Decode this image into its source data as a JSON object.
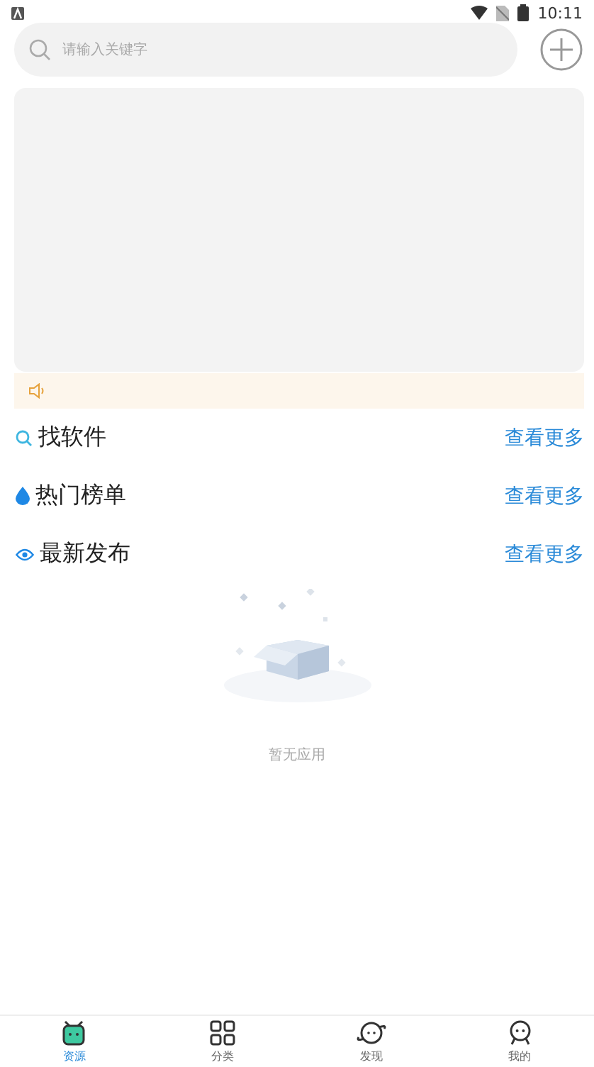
{
  "status_bar": {
    "time": "10:11"
  },
  "search": {
    "placeholder": "请输入关键字"
  },
  "sections": [
    {
      "kind": "search",
      "title": "找软件",
      "more": "查看更多"
    },
    {
      "kind": "drop",
      "title": "热门榜单",
      "more": "查看更多"
    },
    {
      "kind": "eye",
      "title": "最新发布",
      "more": "查看更多"
    }
  ],
  "empty": {
    "text": "暂无应用"
  },
  "tabs": [
    {
      "kind": "robot",
      "label": "资源",
      "selected": true
    },
    {
      "kind": "grid",
      "label": "分类",
      "selected": false
    },
    {
      "kind": "planet",
      "label": "发现",
      "selected": false
    },
    {
      "kind": "face",
      "label": "我的",
      "selected": false
    }
  ]
}
